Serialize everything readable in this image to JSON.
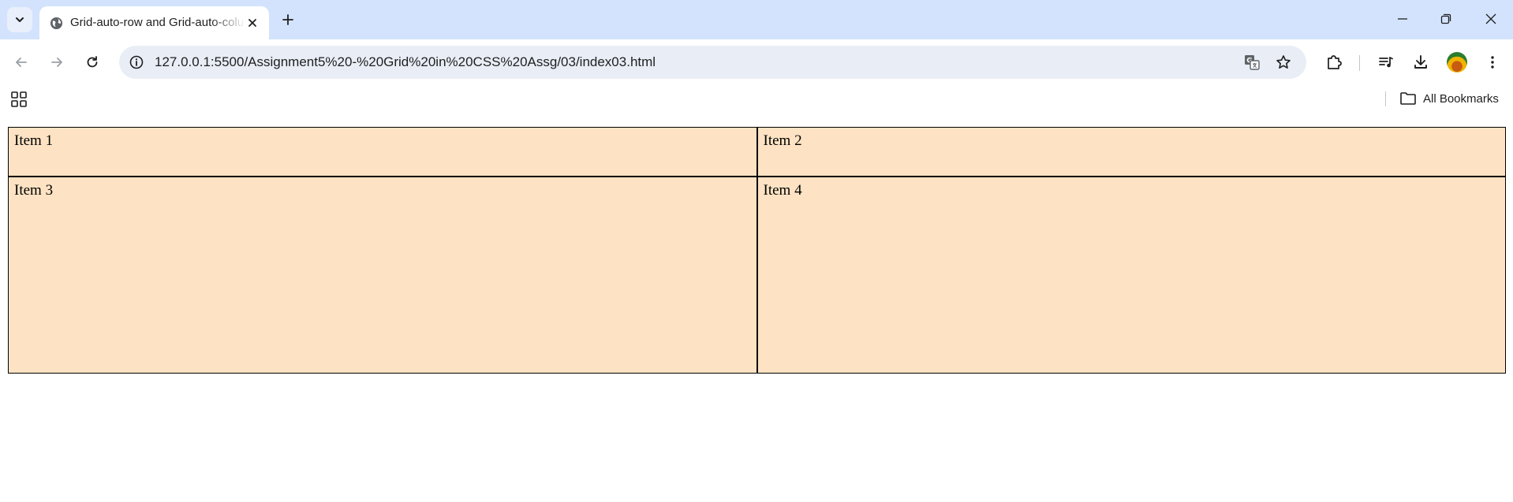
{
  "browser": {
    "tab": {
      "title": "Grid-auto-row and Grid-auto-column"
    },
    "address_bar": {
      "url": "127.0.0.1:5500/Assignment5%20-%20Grid%20in%20CSS%20Assg/03/index03.html"
    },
    "bookmarks_bar": {
      "all_bookmarks_label": "All Bookmarks"
    }
  },
  "page": {
    "items": [
      {
        "label": "Item 1"
      },
      {
        "label": "Item 2"
      },
      {
        "label": "Item 3"
      },
      {
        "label": "Item 4"
      }
    ],
    "item_background": "#fde3c3",
    "item_border": "#000000"
  },
  "colors": {
    "tabstrip": "#d3e3fd",
    "omnibox": "#e9eef6"
  },
  "icons": {
    "tab_search": "chevron-down-icon",
    "favicon": "globe-icon",
    "tab_close": "close-icon",
    "new_tab": "plus-icon",
    "minimize": "minimize-icon",
    "restore": "restore-icon",
    "close_window": "close-icon",
    "back": "back-arrow-icon",
    "forward": "forward-arrow-icon",
    "reload": "reload-icon",
    "site_info": "info-icon",
    "translate": "translate-icon",
    "bookmark_star": "star-icon",
    "extensions": "puzzle-icon",
    "media": "media-queue-icon",
    "downloads": "download-icon",
    "menu": "kebab-menu-icon",
    "apps": "apps-grid-icon",
    "folder": "folder-icon"
  }
}
